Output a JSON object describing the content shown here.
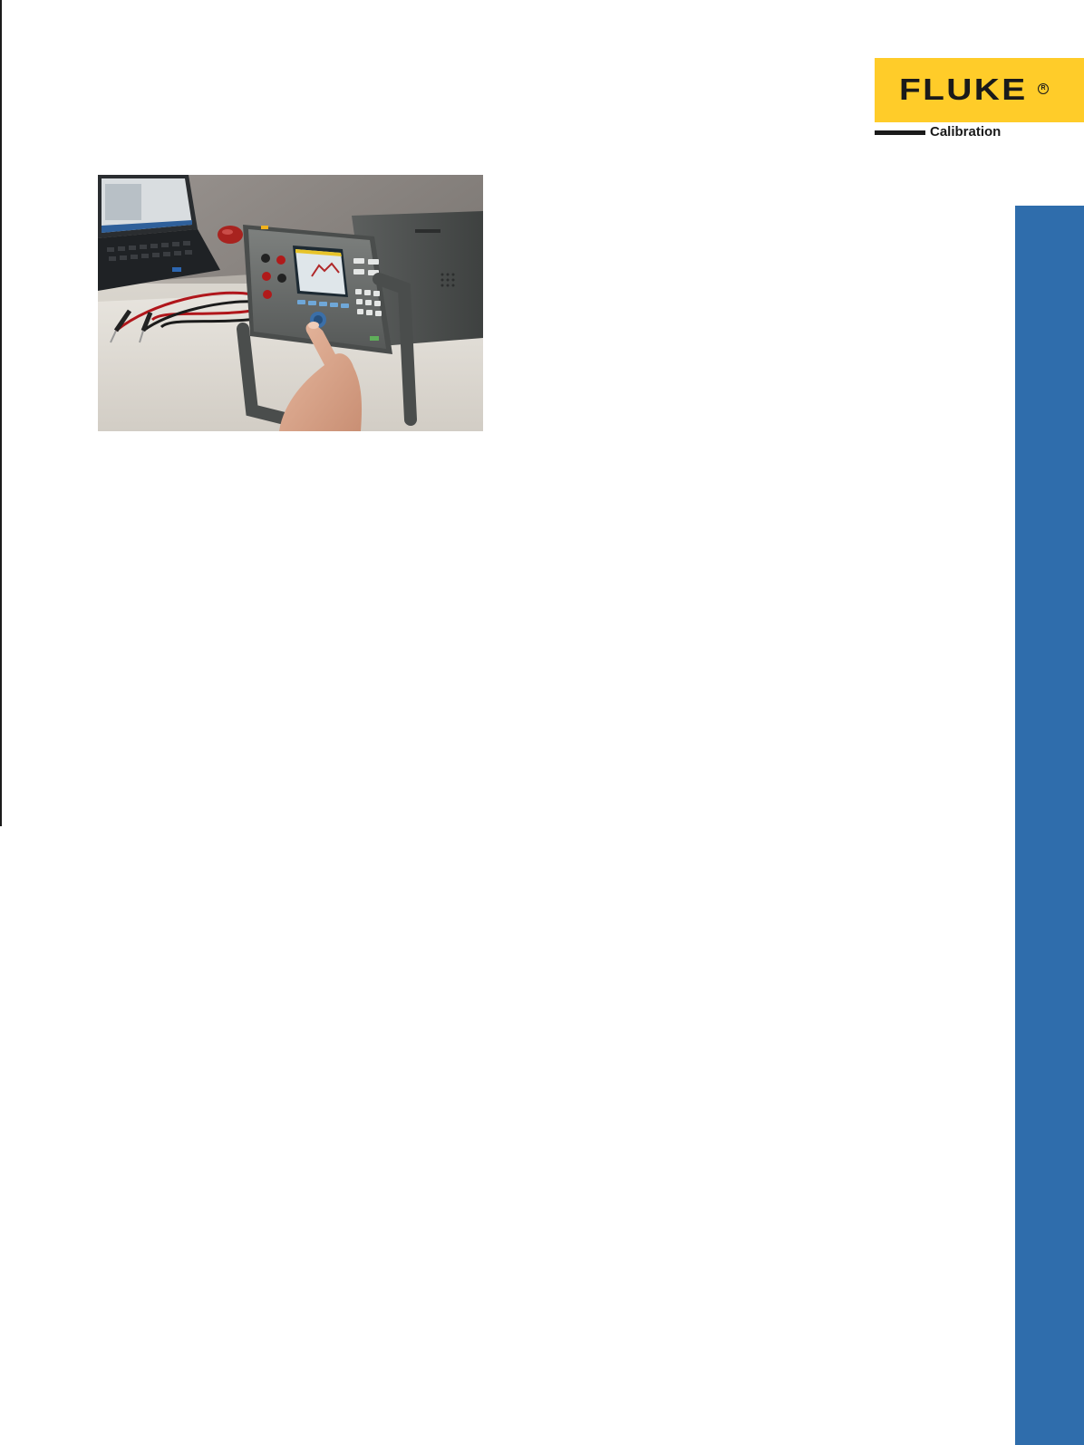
{
  "brand": {
    "name": "FLUKE",
    "registered_mark": "R",
    "division": "Calibration",
    "logo_color": "#ffcc29"
  },
  "accent_band_color": "#2f6dac",
  "photo": {
    "subject": "benchtop-instrument-with-laptop-and-test-leads"
  }
}
